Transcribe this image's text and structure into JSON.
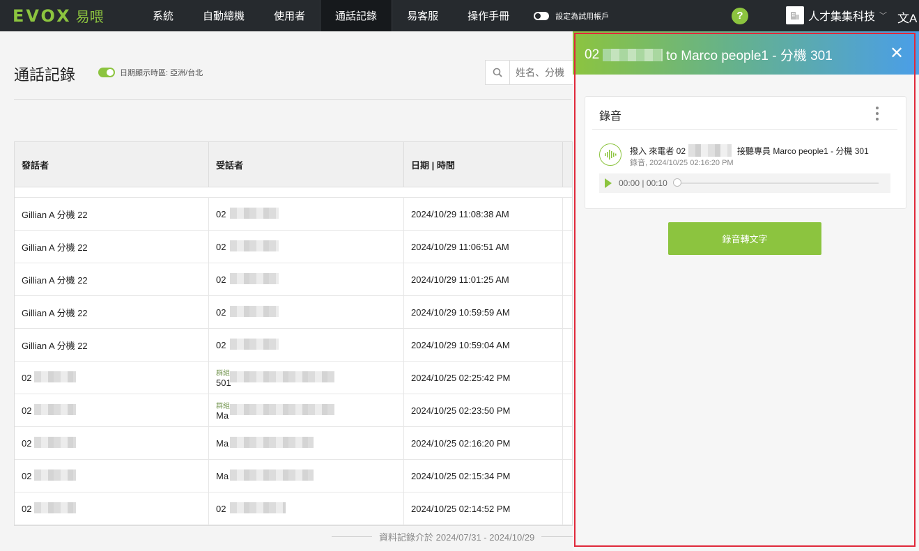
{
  "nav": {
    "logo_text": "EVOX",
    "logo_sub": "易喂",
    "items": [
      {
        "label": "系統",
        "active": false
      },
      {
        "label": "自動總機",
        "active": false
      },
      {
        "label": "使用者",
        "active": false
      },
      {
        "label": "通話記錄",
        "active": true
      },
      {
        "label": "易客服",
        "active": false
      },
      {
        "label": "操作手冊",
        "active": false
      }
    ],
    "trial_label": "設定為試用帳戶",
    "help_label": "?",
    "company_name": "人才集集科技",
    "lang_icon": "文A"
  },
  "page": {
    "title": "通話記錄",
    "timezone_label": "日期顯示時區: 亞洲/台北",
    "search_placeholder": "姓名、分機",
    "columns": [
      "發話者",
      "受話者",
      "日期 | 時間",
      ""
    ],
    "rows": [
      {
        "caller": "Gillian A 分機 22",
        "callee_sub": "",
        "callee": "02",
        "datetime": "2024/10/29 11:08:38 AM"
      },
      {
        "caller": "Gillian A 分機 22",
        "callee_sub": "",
        "callee": "02",
        "datetime": "2024/10/29 11:06:51 AM"
      },
      {
        "caller": "Gillian A 分機 22",
        "callee_sub": "",
        "callee": "02",
        "datetime": "2024/10/29 11:01:25 AM"
      },
      {
        "caller": "Gillian A 分機 22",
        "callee_sub": "",
        "callee": "02",
        "datetime": "2024/10/29 10:59:59 AM"
      },
      {
        "caller": "Gillian A 分機 22",
        "callee_sub": "",
        "callee": "02",
        "datetime": "2024/10/29 10:59:04 AM"
      },
      {
        "caller": "02",
        "callee_sub": "群組",
        "callee": "501",
        "datetime": "2024/10/25 02:25:42 PM"
      },
      {
        "caller": "02",
        "callee_sub": "群組",
        "callee": "Ma",
        "datetime": "2024/10/25 02:23:50 PM"
      },
      {
        "caller": "02",
        "callee_sub": "",
        "callee": "Ma",
        "datetime": "2024/10/25 02:16:20 PM"
      },
      {
        "caller": "02",
        "callee_sub": "",
        "callee": "Ma",
        "datetime": "2024/10/25 02:15:34 PM"
      },
      {
        "caller": "02",
        "callee_sub": "",
        "callee": "02",
        "datetime": "2024/10/25 02:14:52 PM"
      }
    ],
    "range_note": "資料記錄介於 2024/07/31 - 2024/10/29"
  },
  "panel": {
    "title_prefix": "02",
    "title_suffix": "to Marco people1 - 分機 301",
    "close_label": "✕",
    "card_title": "錄音",
    "rec_prefix": "撥入 來電者 02",
    "rec_suffix": "接聽專員 Marco people1 - 分機 301",
    "rec_meta": "錄音, 2024/10/25 02:16:20 PM",
    "player_time": "00:00 | 00:10",
    "progress": 0,
    "stt_button": "錄音轉文字"
  },
  "colors": {
    "accent": "#8cc43f",
    "nav_bg": "#262a2e",
    "highlight_border": "#e0283a"
  }
}
